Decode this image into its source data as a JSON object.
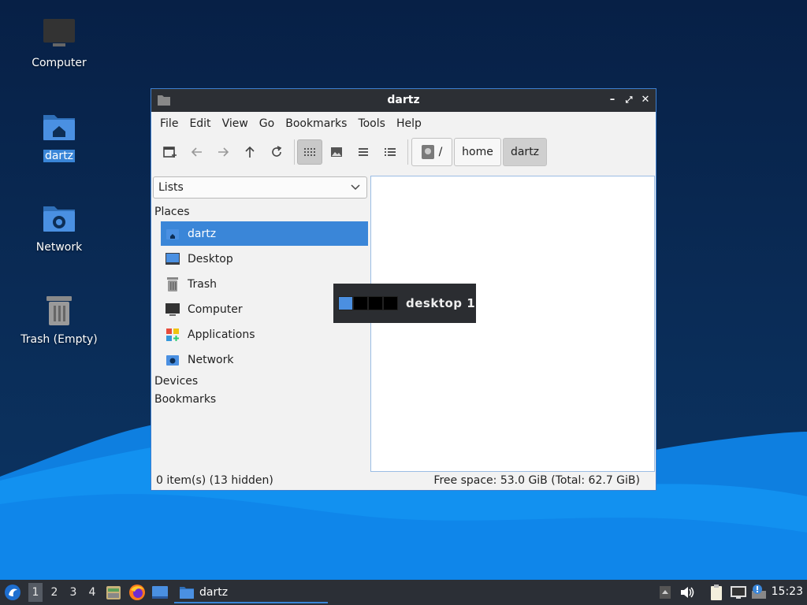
{
  "desktop": {
    "icons": [
      {
        "label": "Computer"
      },
      {
        "label": "dartz"
      },
      {
        "label": "Network"
      },
      {
        "label": "Trash (Empty)"
      }
    ]
  },
  "window": {
    "title": "dartz",
    "controls": {
      "minimize": "–",
      "maximize": "⤢",
      "close": "✕"
    },
    "menu": [
      "File",
      "Edit",
      "View",
      "Go",
      "Bookmarks",
      "Tools",
      "Help"
    ],
    "path": {
      "root": "/",
      "home": "home",
      "current": "dartz"
    },
    "side_pane": {
      "mode": "Lists",
      "places_heading": "Places",
      "places": [
        {
          "label": "dartz",
          "icon": "home-folder-icon"
        },
        {
          "label": "Desktop",
          "icon": "desktop-icon"
        },
        {
          "label": "Trash",
          "icon": "trash-icon"
        },
        {
          "label": "Computer",
          "icon": "computer-icon"
        },
        {
          "label": "Applications",
          "icon": "applications-icon"
        },
        {
          "label": "Network",
          "icon": "network-icon"
        }
      ],
      "devices_heading": "Devices",
      "bookmarks_heading": "Bookmarks"
    },
    "status": {
      "items": "0 item(s) (13 hidden)",
      "free_space": "Free space: 53.0 GiB (Total: 62.7 GiB)"
    }
  },
  "workspace_popup": {
    "label": "desktop 1"
  },
  "taskbar": {
    "workspaces": [
      "1",
      "2",
      "3",
      "4"
    ],
    "task_label": "dartz",
    "clock": "15:23"
  },
  "colors": {
    "accent": "#3a86d8",
    "panel": "#2b2f36"
  }
}
